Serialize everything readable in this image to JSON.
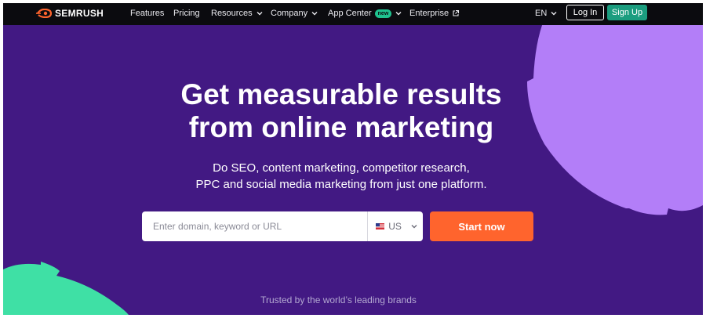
{
  "nav": {
    "logo_text": "SEMRUSH",
    "items": [
      {
        "label": "Features",
        "dropdown": false
      },
      {
        "label": "Pricing",
        "dropdown": false
      },
      {
        "label": "Resources",
        "dropdown": true
      },
      {
        "label": "Company",
        "dropdown": true
      },
      {
        "label": "App Center",
        "dropdown": true,
        "badge": "new"
      },
      {
        "label": "Enterprise",
        "external": true
      }
    ],
    "language": "EN",
    "login_label": "Log In",
    "signup_label": "Sign Up"
  },
  "hero": {
    "headline_line1": "Get measurable results",
    "headline_line2": "from online marketing",
    "sub_line1": "Do SEO, content marketing, competitor research,",
    "sub_line2": "PPC and social media marketing from just one platform.",
    "search_placeholder": "Enter domain, keyword or URL",
    "country": "US",
    "cta_label": "Start now",
    "trusted_text": "Trusted by the world’s leading brands"
  },
  "colors": {
    "background": "#421983",
    "navbar": "#0b0b0f",
    "accent_orange": "#ff642d",
    "signup_green": "#1b9d7f",
    "lavender_shape": "#b37ef8",
    "green_shape": "#3fe0a5"
  },
  "icons": [
    "semrush-logo-icon",
    "chevron-down-icon",
    "external-link-icon",
    "us-flag-icon"
  ]
}
